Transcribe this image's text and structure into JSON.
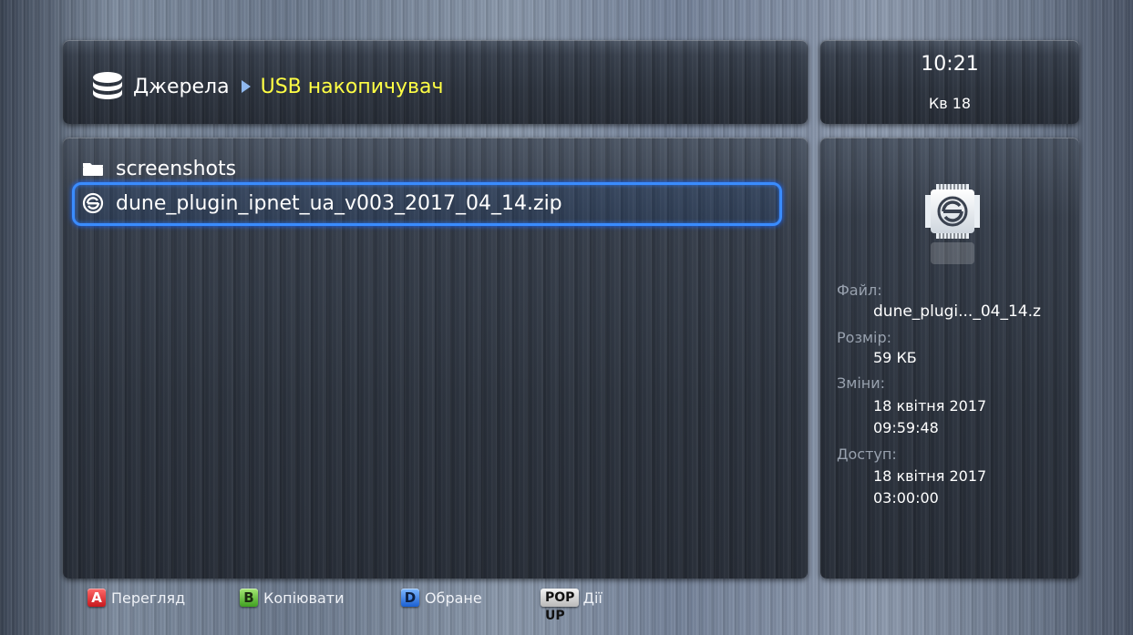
{
  "header": {
    "breadcrumb_root": "Джерела",
    "breadcrumb_current": "USB накопичувач",
    "icons": {
      "root": "database-icon",
      "separator": "triangle-right-icon"
    },
    "current_color": "#ffff44"
  },
  "clock": {
    "time": "10:21",
    "date": "Кв 18"
  },
  "file_list": {
    "items": [
      {
        "name": "screenshots",
        "icon": "folder-icon",
        "selected": false
      },
      {
        "name": "dune_plugin_ipnet_ua_v003_2017_04_14.zip",
        "icon": "plugin-archive-icon",
        "selected": true
      }
    ],
    "selection_color": "#3a8cff"
  },
  "info": {
    "icon": "chip-icon",
    "file_label": "Файл:",
    "file_value": "dune_plugi..._04_14.z",
    "size_label": "Розмір:",
    "size_value": "59 КБ",
    "modified_label": "Зміни:",
    "modified_date": "18 квітня 2017",
    "modified_time": "09:59:48",
    "access_label": "Доступ:",
    "access_date": "18 квітня 2017",
    "access_time": "03:00:00"
  },
  "footer": {
    "hints": [
      {
        "key": "A",
        "label": "Перегляд",
        "color": "#e02a2a"
      },
      {
        "key": "B",
        "label": "Копіювати",
        "color": "#5fbf34"
      },
      {
        "key": "D",
        "label": "Обране",
        "color": "#2f7be8"
      },
      {
        "key": "POP UP",
        "label": "Дії",
        "color": "#d8d8d8"
      }
    ]
  }
}
